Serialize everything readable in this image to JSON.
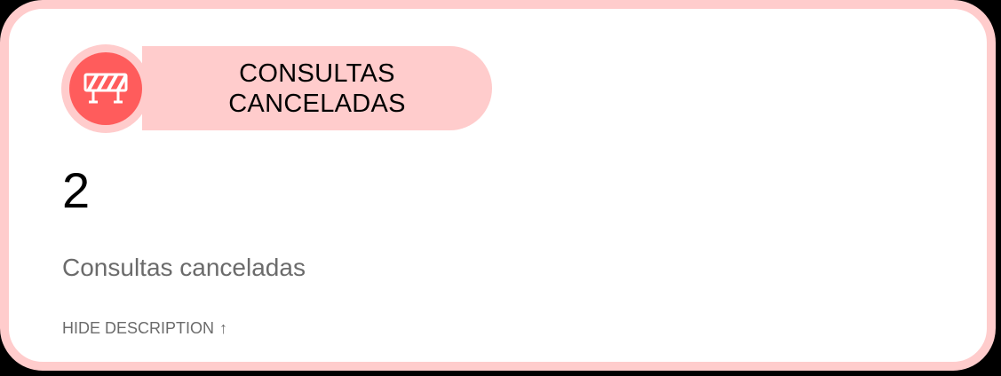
{
  "card": {
    "title_line1": "CONSULTAS",
    "title_line2": "CANCELADAS",
    "icon": "barrier-icon",
    "value": "2",
    "description": "Consultas canceladas",
    "toggle_label": "HIDE DESCRIPTION",
    "toggle_arrow": "↑"
  },
  "colors": {
    "card_border": "#ffcccc",
    "icon_background": "#ff5c5c",
    "pill_background": "#ffcccc",
    "description_text": "#6b6b6b"
  }
}
